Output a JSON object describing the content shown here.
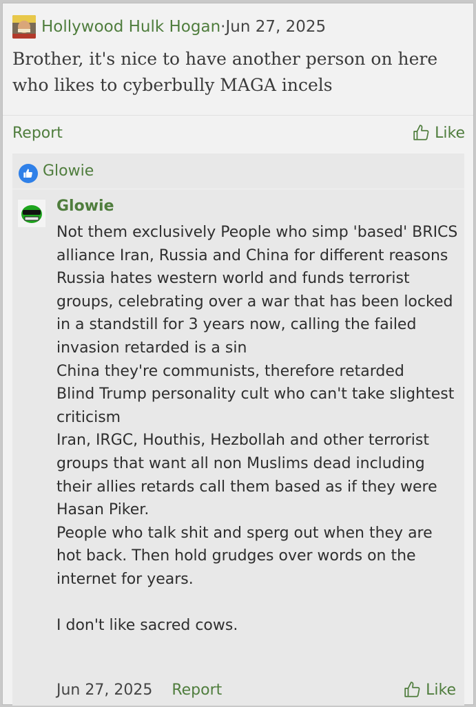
{
  "post": {
    "author": "Hollywood Hulk Hogan",
    "separator": " · ",
    "date": "Jun 27, 2025",
    "body": "Brother, it's nice to have another person on here who likes to cyberbully MAGA incels",
    "actions": {
      "report": "Report",
      "like": "Like"
    }
  },
  "reply": {
    "reaction": {
      "icon": "thumbs-up-icon",
      "color": "#2f80e8",
      "user": "Glowie"
    },
    "author": "Glowie",
    "body": "Not them exclusively People who simp 'based' BRICS alliance Iran, Russia and China for different reasons\nRussia hates western world and funds terrorist groups, celebrating over a war that has been locked in a standstill for 3 years now, calling the failed invasion retarded is a sin\nChina they're communists, therefore retarded\nBlind Trump personality cult who can't take slightest criticism\nIran, IRGC, Houthis, Hezbollah and other terrorist groups that want all non Muslims dead including their allies retards call them based as if they were Hasan Piker.\nPeople who talk shit and sperg out when they are hot back. Then hold grudges over words on the internet for years.\n\nI don't like sacred cows.",
    "date": "Jun 27, 2025",
    "actions": {
      "report": "Report",
      "like": "Like"
    }
  },
  "colors": {
    "link": "#4f7d3d",
    "background": "#f2f2f2",
    "reply_background": "#e8e8e8"
  }
}
